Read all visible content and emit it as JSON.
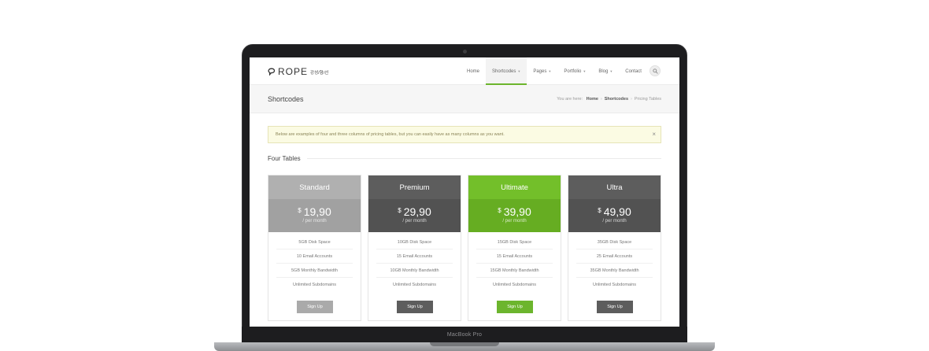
{
  "device": {
    "label": "MacBook Pro"
  },
  "header": {
    "logo_text": "ROPE",
    "logo_sub": "강성/형/선",
    "nav": [
      {
        "label": "Home",
        "caret": false,
        "active": false
      },
      {
        "label": "Shortcodes",
        "caret": true,
        "active": true
      },
      {
        "label": "Pages",
        "caret": true,
        "active": false
      },
      {
        "label": "Portfolio",
        "caret": true,
        "active": false
      },
      {
        "label": "Blog",
        "caret": true,
        "active": false
      },
      {
        "label": "Contact",
        "caret": false,
        "active": false
      }
    ],
    "search_icon": "search-icon"
  },
  "title_bar": {
    "title": "Shortcodes",
    "breadcrumb_prefix": "You are here:",
    "breadcrumb": [
      "Home",
      "Shortcodes",
      "Pricing Tables"
    ]
  },
  "alert": {
    "text": "Below are examples of four and three columns of pricing tables, but you can easily have as many columns as you want.",
    "close": "×"
  },
  "section": {
    "title": "Four Tables"
  },
  "colors": {
    "accent": "#6cb52d",
    "standard_head": "#b0b0b0",
    "standard_price": "#a1a1a1",
    "standard_button": "#aaaaaa",
    "premium_head": "#5d5d5d",
    "premium_price": "#525252",
    "premium_button": "#5d5d5d",
    "ultimate_head": "#73bf2a",
    "ultimate_price": "#66ad22",
    "ultimate_button": "#6cb52d",
    "ultra_head": "#5d5d5d",
    "ultra_price": "#525252",
    "ultra_button": "#5d5d5d"
  },
  "plans": [
    {
      "name": "Standard",
      "currency": "$",
      "price": "19,90",
      "period": "/ per month",
      "features": [
        "5GB Disk Space",
        "10 Email Accounts",
        "5GB Monthly Bandwidth",
        "Unlimited Subdomains"
      ],
      "button": "Sign Up"
    },
    {
      "name": "Premium",
      "currency": "$",
      "price": "29,90",
      "period": "/ per month",
      "features": [
        "10GB Disk Space",
        "15 Email Accounts",
        "10GB Monthly Bandwidth",
        "Unlimited Subdomains"
      ],
      "button": "Sign Up"
    },
    {
      "name": "Ultimate",
      "currency": "$",
      "price": "39,90",
      "period": "/ per month",
      "features": [
        "15GB Disk Space",
        "15 Email Accounts",
        "15GB Monthly Bandwidth",
        "Unlimited Subdomains"
      ],
      "button": "Sign Up"
    },
    {
      "name": "Ultra",
      "currency": "$",
      "price": "49,90",
      "period": "/ per month",
      "features": [
        "35GB Disk Space",
        "25 Email Accounts",
        "35GB Monthly Bandwidth",
        "Unlimited Subdomains"
      ],
      "button": "Sign Up"
    }
  ]
}
